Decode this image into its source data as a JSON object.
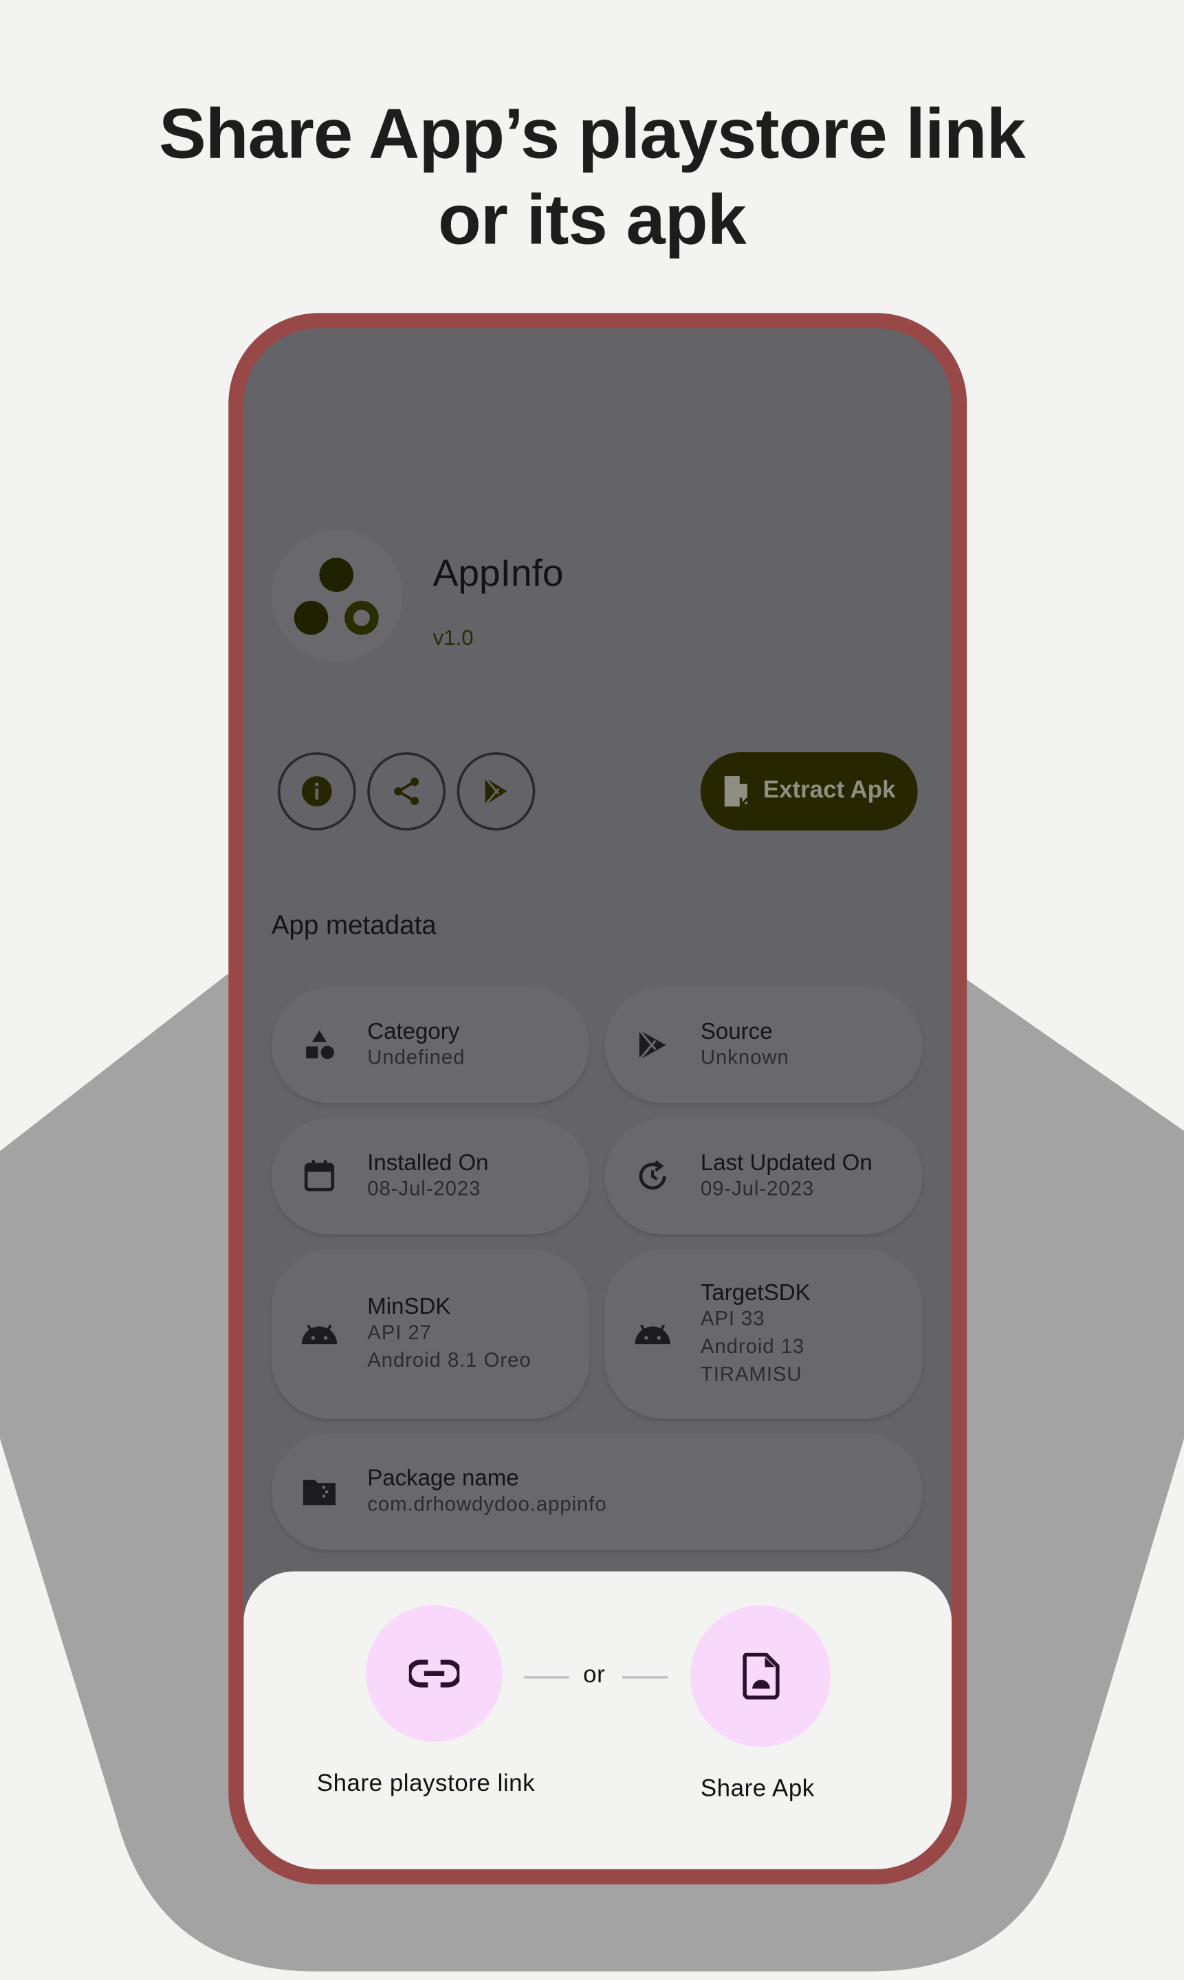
{
  "headline": {
    "line1": "Share App’s playstore link",
    "line2": "or its apk"
  },
  "app": {
    "name": "AppInfo",
    "version": "v1.0"
  },
  "actions": {
    "info_icon": "info-icon",
    "share_icon": "share-icon",
    "playstore_icon": "play-store-icon",
    "extract_label": "Extract Apk"
  },
  "metadata": {
    "title": "App metadata",
    "items": [
      {
        "title": "Category",
        "values": [
          "Undefined"
        ],
        "icon": "category-shapes-icon"
      },
      {
        "title": "Source",
        "values": [
          "Unknown"
        ],
        "icon": "play-store-icon"
      },
      {
        "title": "Installed On",
        "values": [
          "08-Jul-2023"
        ],
        "icon": "calendar-icon"
      },
      {
        "title": "Last Updated On",
        "values": [
          "09-Jul-2023"
        ],
        "icon": "update-icon"
      },
      {
        "title": "MinSDK",
        "values": [
          "API 27",
          "Android 8.1 Oreo"
        ],
        "icon": "android-icon"
      },
      {
        "title": "TargetSDK",
        "values": [
          "API 33",
          "Android 13",
          "TIRAMISU"
        ],
        "icon": "android-icon"
      },
      {
        "title": "Package name",
        "values": [
          "com.drhowdydoo.appinfo"
        ],
        "icon": "folder-zip-icon"
      }
    ]
  },
  "sheet": {
    "link_label": "Share playstore link",
    "or_label": "or",
    "apk_label": "Share Apk"
  },
  "colors": {
    "frame": "#984846",
    "accent_pink": "#f8d8fb",
    "extract_bg": "#262600"
  }
}
